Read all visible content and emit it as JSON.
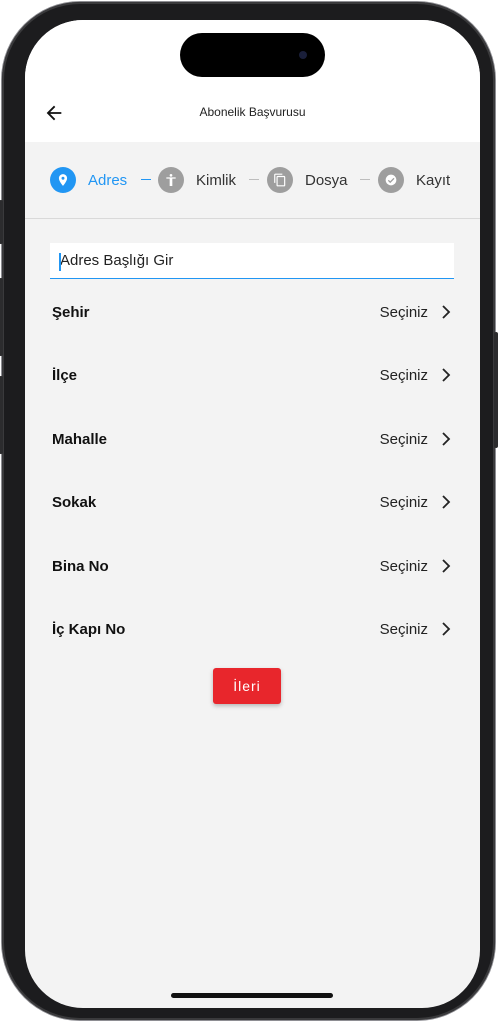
{
  "appbar": {
    "title": "Abonelik Başvurusu"
  },
  "stepper": {
    "steps": [
      {
        "label": "Adres",
        "icon": "location-pin-icon",
        "active": true
      },
      {
        "label": "Kimlik",
        "icon": "person-icon",
        "active": false
      },
      {
        "label": "Dosya",
        "icon": "document-icon",
        "active": false
      },
      {
        "label": "Kayıt",
        "icon": "check-icon",
        "active": false
      }
    ]
  },
  "form": {
    "address_title_value": "Adres Başlığı Gir",
    "rows": [
      {
        "label": "Şehir",
        "value": "Seçiniz"
      },
      {
        "label": "İlçe",
        "value": "Seçiniz"
      },
      {
        "label": "Mahalle",
        "value": "Seçiniz"
      },
      {
        "label": "Sokak",
        "value": "Seçiniz"
      },
      {
        "label": "Bina No",
        "value": "Seçiniz"
      },
      {
        "label": "İç Kapı No",
        "value": "Seçiniz"
      }
    ],
    "next_label": "İleri"
  },
  "colors": {
    "accent": "#2196f3",
    "inactive_step": "#9e9e9e",
    "primary_button": "#e8262c",
    "background": "#f3f3f3"
  }
}
